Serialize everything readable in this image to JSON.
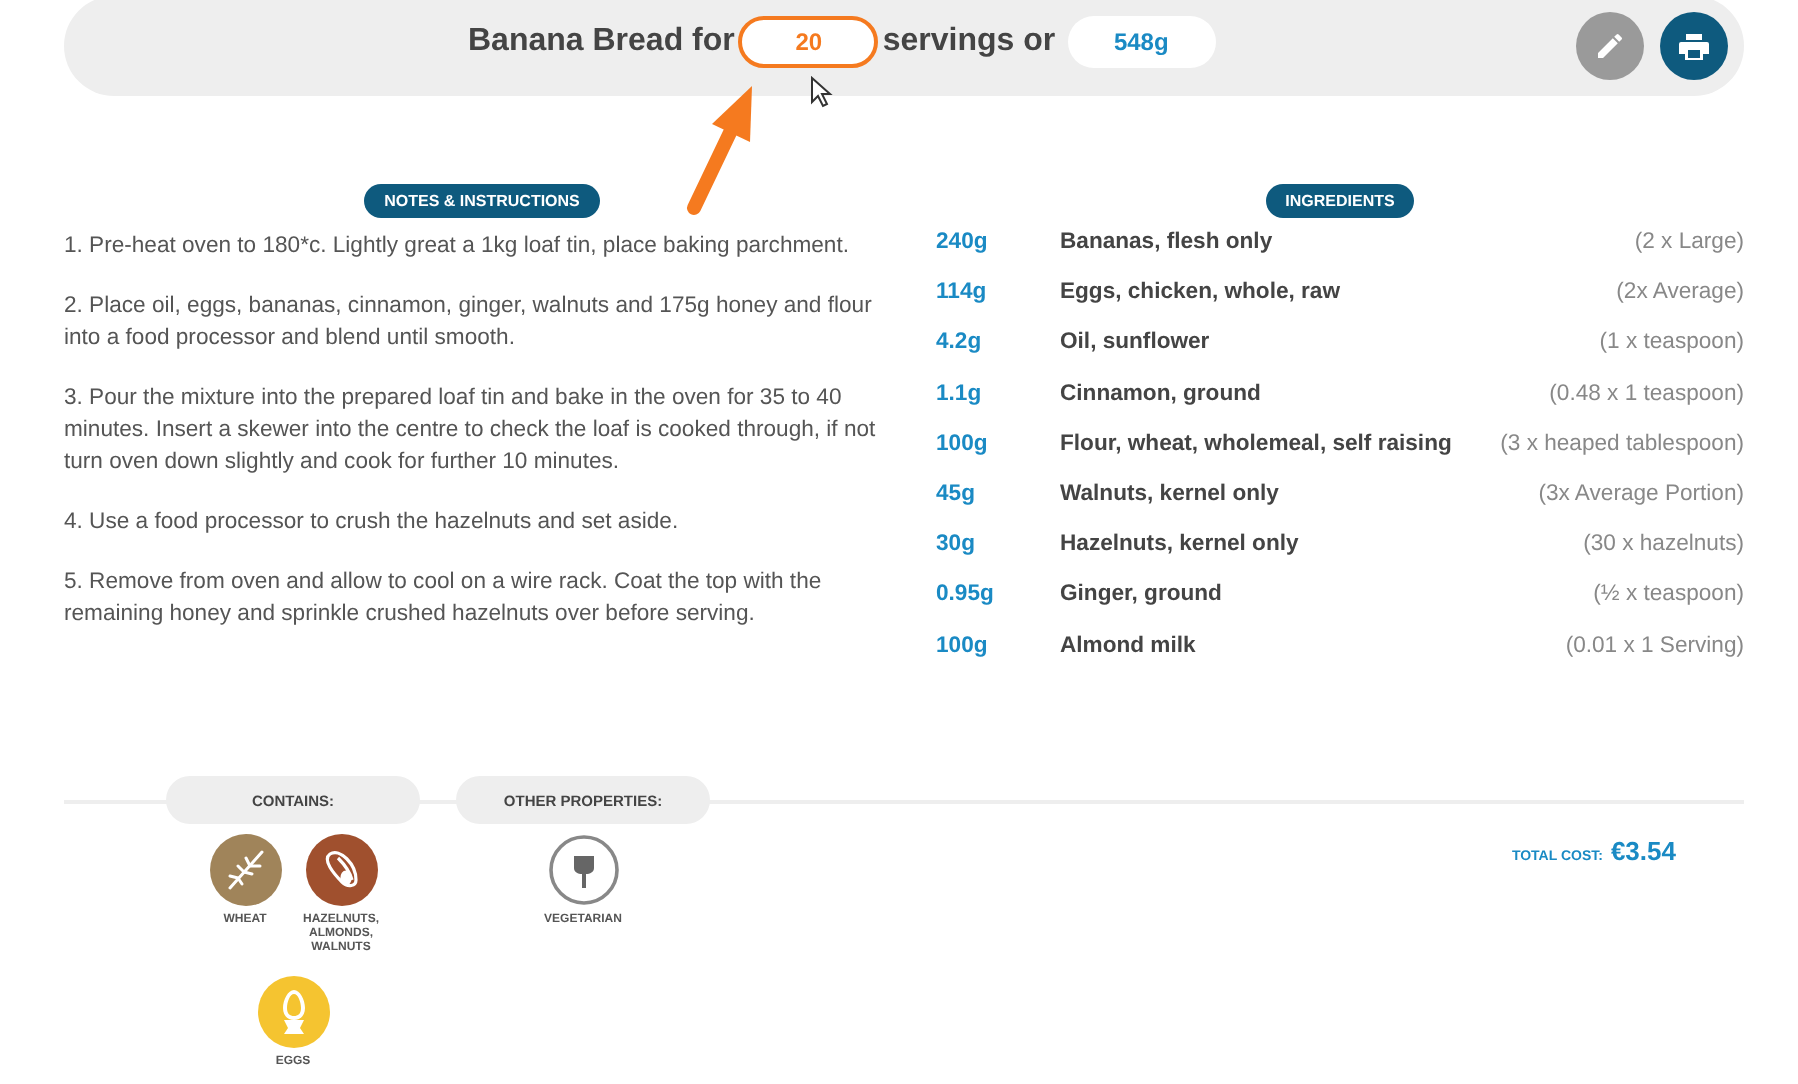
{
  "header": {
    "title_before": "Banana Bread for",
    "servings": "20",
    "title_middle": "servings or",
    "weight": "548g",
    "servings_focused": true
  },
  "notes": {
    "heading": "NOTES & INSTRUCTIONS",
    "steps": [
      "1.  Pre-heat oven to 180*c.  Lightly great a 1kg loaf tin, place baking parchment.",
      "2.  Place oil, eggs, bananas, cinnamon, ginger, walnuts and 175g honey and flour into a food processor and blend until smooth.",
      "3.  Pour the mixture into the prepared loaf tin and bake in the oven for 35 to 40 minutes.  Insert a skewer into the centre to check the loaf is cooked through, if not turn oven down slightly and cook for further 10 minutes.",
      "4.  Use a food processor to crush the hazelnuts and set aside.",
      "5. Remove from oven and allow to cool on a wire rack.  Coat the top with the remaining honey and sprinkle crushed hazelnuts over  before serving."
    ]
  },
  "ingredients": {
    "heading": "INGREDIENTS",
    "rows": [
      {
        "amount": "240g",
        "name": "Bananas, flesh only",
        "measure": "(2 x Large)"
      },
      {
        "amount": "114g",
        "name": "Eggs, chicken, whole, raw",
        "measure": "(2x Average)"
      },
      {
        "amount": "4.2g",
        "name": "Oil, sunflower",
        "measure": "(1 x teaspoon)"
      },
      {
        "amount": "1.1g",
        "name": "Cinnamon, ground",
        "measure": "(0.48 x 1 teaspoon)"
      },
      {
        "amount": "100g",
        "name": "Flour, wheat, wholemeal, self raising",
        "measure": "(3 x heaped tablespoon)"
      },
      {
        "amount": "45g",
        "name": "Walnuts, kernel only",
        "measure": "(3x Average Portion)"
      },
      {
        "amount": "30g",
        "name": "Hazelnuts, kernel only",
        "measure": "(30 x hazelnuts)"
      },
      {
        "amount": "0.95g",
        "name": "Ginger, ground",
        "measure": "(½ x teaspoon)"
      },
      {
        "amount": "100g",
        "name": "Almond milk",
        "measure": "(0.01 x 1 Serving)"
      }
    ]
  },
  "contains": {
    "heading": "CONTAINS:",
    "items": [
      {
        "kind": "wheat",
        "label": "WHEAT",
        "color": "#a0845a"
      },
      {
        "kind": "nuts",
        "label": "HAZELNUTS, ALMONDS, WALNUTS",
        "color": "#a0502e"
      },
      {
        "kind": "eggs",
        "label": "EGGS",
        "color": "#f5c430"
      }
    ]
  },
  "other_properties": {
    "heading": "OTHER PROPERTIES:",
    "items": [
      {
        "kind": "vegetarian",
        "label": "VEGETARIAN"
      }
    ]
  },
  "total_cost": {
    "label": "TOTAL COST:",
    "value": "€3.54"
  }
}
